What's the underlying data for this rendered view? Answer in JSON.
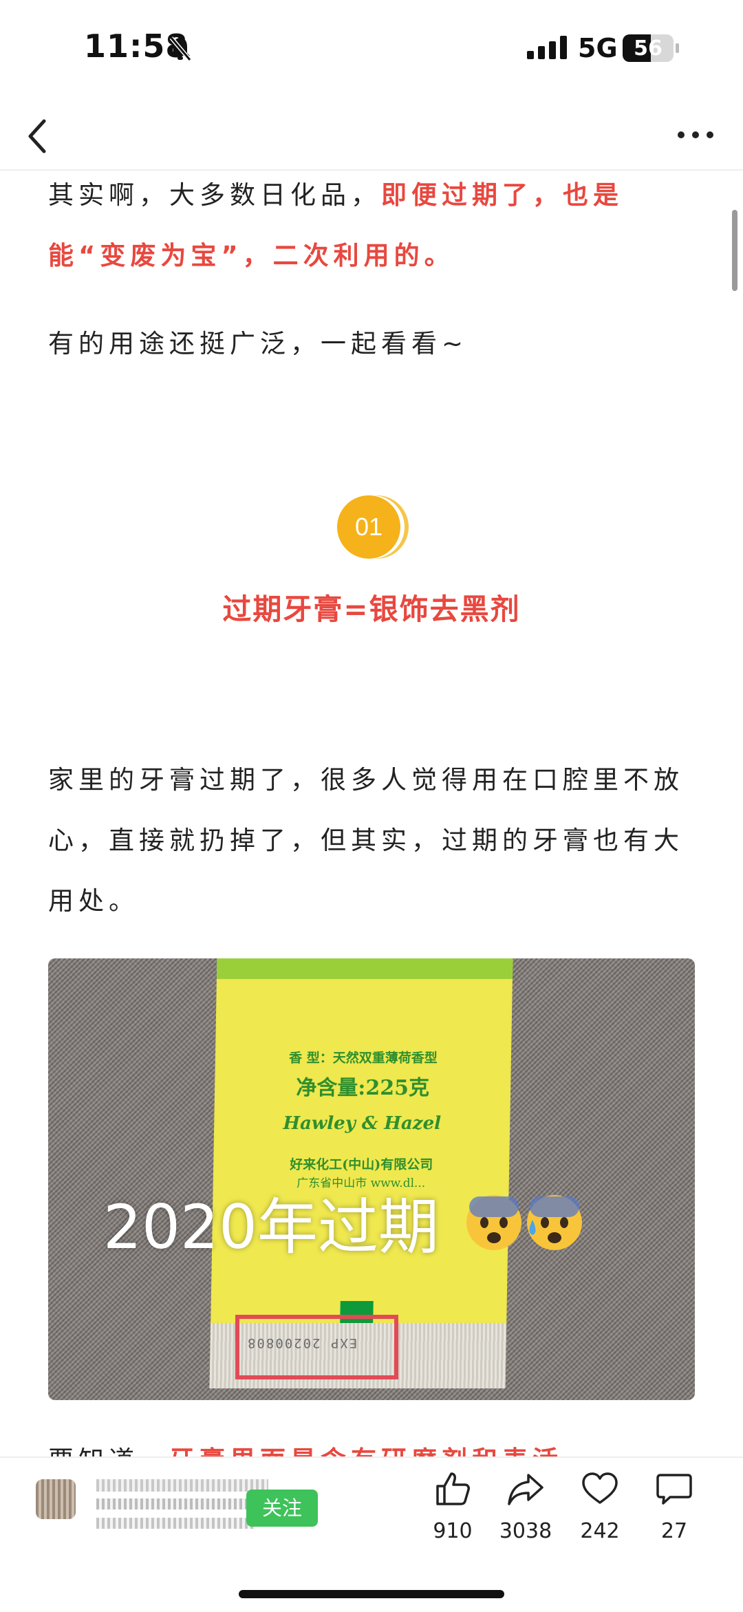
{
  "status_bar": {
    "time": "11:58",
    "network": "5G",
    "battery": "56",
    "battery_level": 0.56
  },
  "article": {
    "para1_plain": "其实啊，大多数日化品，",
    "para1_red": "即便过期了，也是能“变废为宝”，二次利用的。",
    "para2": "有的用途还挺广泛，一起看看~",
    "section_number": "01",
    "section_title": "过期牙膏=银饰去黑剂",
    "para3": "家里的牙膏过期了，很多人觉得用在口腔里不放心，直接就扔掉了，但其实，过期的牙膏也有大用处。",
    "peek_plain": "要知道，",
    "peek_red": "牙膏里面是含有研磨剂和表活"
  },
  "photo": {
    "overlay_caption": "2020年过期",
    "tube_line1": "香  型：天然双重薄荷香型",
    "tube_line2": "净含量:225克",
    "tube_line3": "Hawley & Hazel",
    "tube_line4": "好来化工(中山)有限公司",
    "tube_line5": "广东省中山市 www.dl...",
    "tube_code": "EXP 20200808"
  },
  "bottom_bar": {
    "follow_label": "关注",
    "likes": "910",
    "shares": "3038",
    "favorites": "242",
    "comments": "27"
  },
  "colors": {
    "accent_red": "#e8483f",
    "follow_green": "#3ec25a",
    "badge_orange": "#f6b21a"
  },
  "icons": [
    "back-arrow-icon",
    "more-icon",
    "bell-slash-icon",
    "signal-icon",
    "thumbs-up-icon",
    "share-icon",
    "heart-icon",
    "comment-icon"
  ]
}
